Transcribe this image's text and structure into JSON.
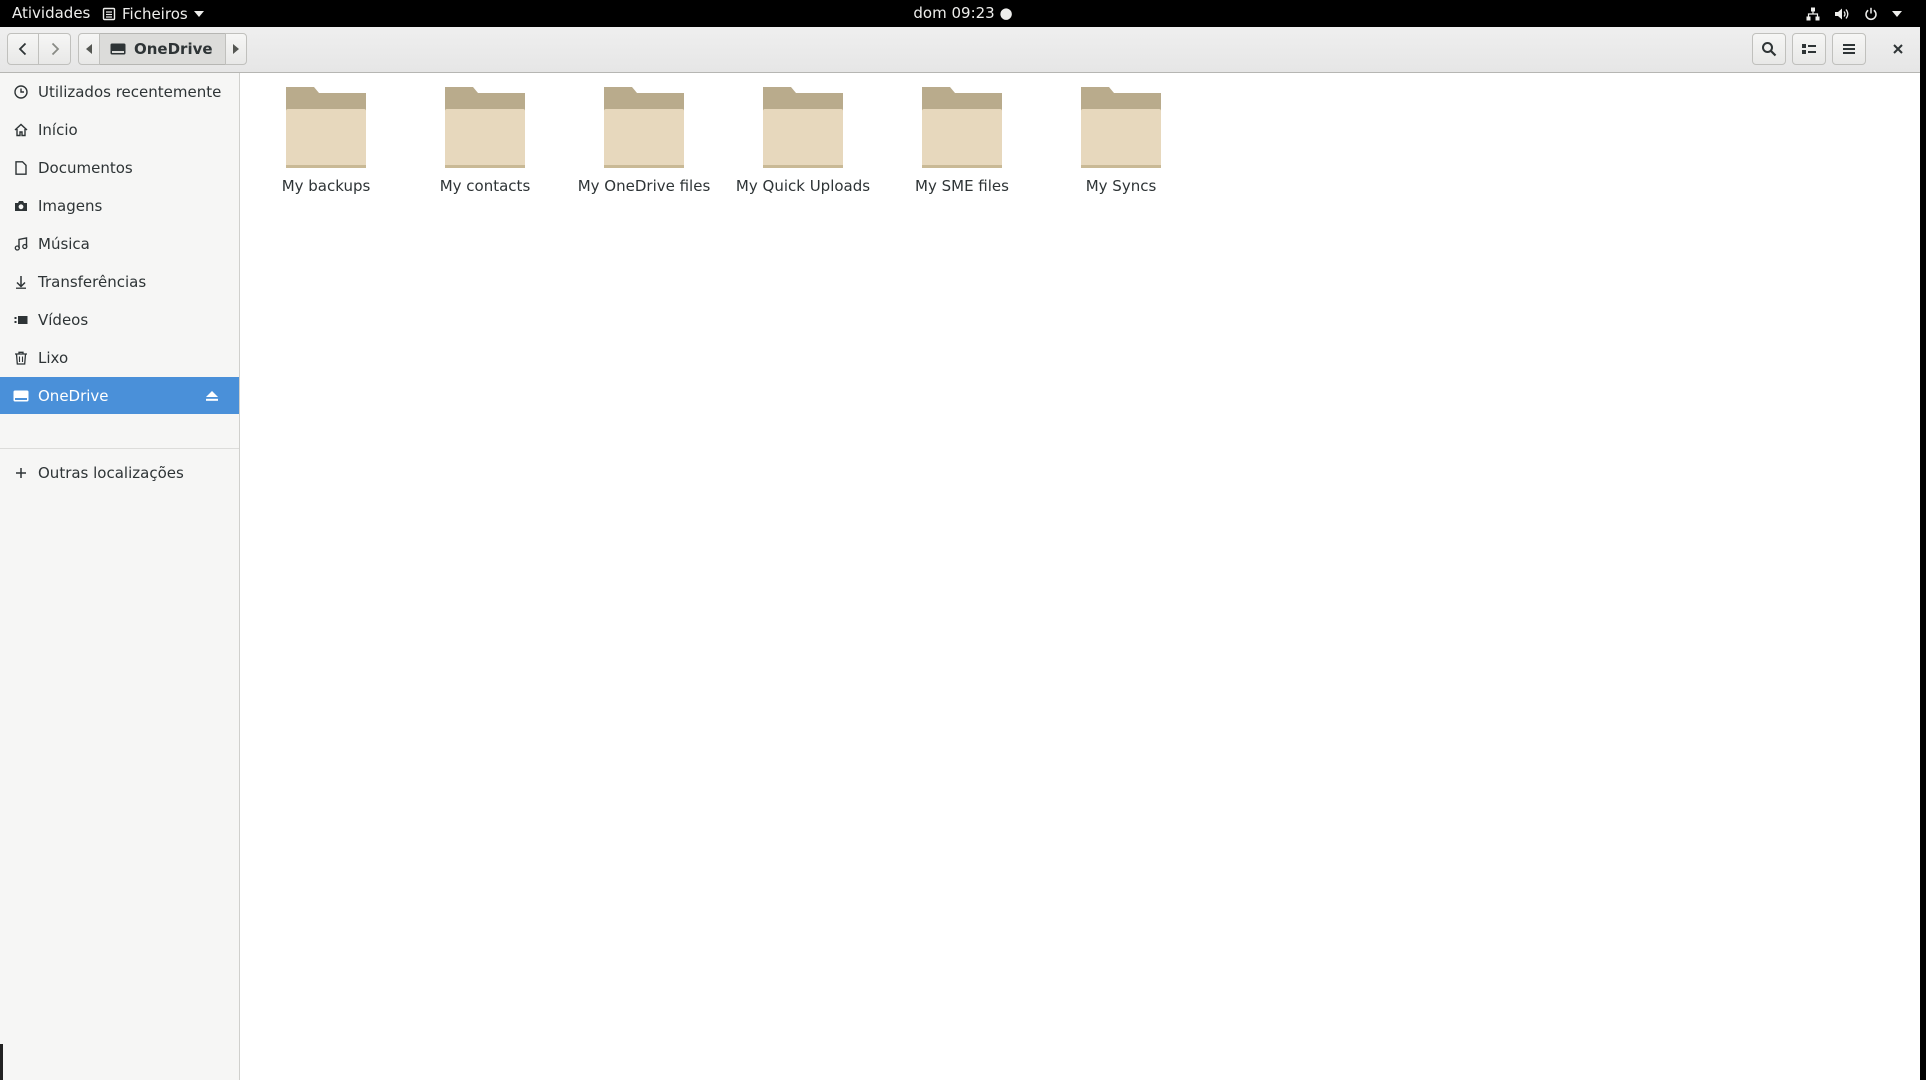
{
  "topbar": {
    "activities": "Atividades",
    "app_name": "Ficheiros",
    "clock": "dom 09:23"
  },
  "headerbar": {
    "path_current": "OneDrive"
  },
  "sidebar": {
    "items": [
      {
        "label": "Utilizados recentemente",
        "icon": "clock-icon"
      },
      {
        "label": "Início",
        "icon": "home-icon"
      },
      {
        "label": "Documentos",
        "icon": "document-icon"
      },
      {
        "label": "Imagens",
        "icon": "camera-icon"
      },
      {
        "label": "Música",
        "icon": "music-icon"
      },
      {
        "label": "Transferências",
        "icon": "download-icon"
      },
      {
        "label": "Vídeos",
        "icon": "video-icon"
      },
      {
        "label": "Lixo",
        "icon": "trash-icon"
      },
      {
        "label": "OneDrive",
        "icon": "drive-icon",
        "selected": true
      }
    ],
    "other_locations": "Outras localizações"
  },
  "folders": [
    {
      "name": "My backups"
    },
    {
      "name": "My contacts"
    },
    {
      "name": "My OneDrive files"
    },
    {
      "name": "My Quick Uploads"
    },
    {
      "name": "My SME files"
    },
    {
      "name": "My Syncs"
    }
  ],
  "colors": {
    "selection": "#4a90d9",
    "folder_tab": "#b9ab8c",
    "folder_body": "#e7d8bd"
  }
}
